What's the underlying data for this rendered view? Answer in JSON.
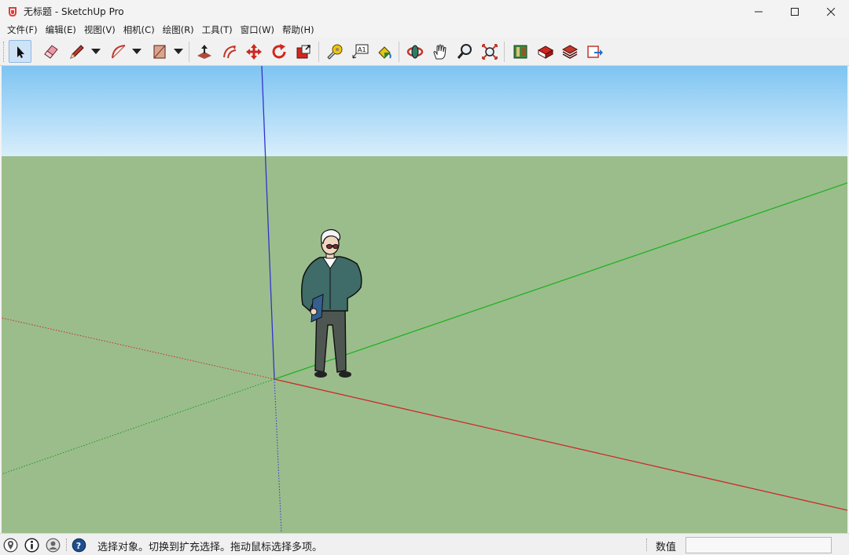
{
  "window": {
    "title": "无标题 - SketchUp Pro",
    "app_icon": "sketchup-logo-icon",
    "controls": [
      "minimize-icon",
      "maximize-icon",
      "close-icon"
    ]
  },
  "menu": {
    "items": [
      "文件(F)",
      "编辑(E)",
      "视图(V)",
      "相机(C)",
      "绘图(R)",
      "工具(T)",
      "窗口(W)",
      "帮助(H)"
    ]
  },
  "toolbar": {
    "tools": [
      {
        "name": "select-tool",
        "icon": "arrow-pointer-icon",
        "active": true
      },
      {
        "name": "eraser-tool",
        "icon": "eraser-icon"
      },
      {
        "name": "line-tool",
        "icon": "pencil-icon",
        "dropdown": true
      },
      {
        "name": "arc-tool",
        "icon": "arc-icon",
        "dropdown": true
      },
      {
        "name": "rectangle-tool",
        "icon": "rectangle-icon",
        "dropdown": true
      },
      {
        "name": "push-pull-tool",
        "icon": "push-pull-icon"
      },
      {
        "name": "offset-tool",
        "icon": "offset-icon"
      },
      {
        "name": "move-tool",
        "icon": "move-icon"
      },
      {
        "name": "rotate-tool",
        "icon": "rotate-icon"
      },
      {
        "name": "scale-tool",
        "icon": "scale-icon"
      },
      {
        "name": "tape-measure-tool",
        "icon": "tape-measure-icon"
      },
      {
        "name": "text-tool",
        "icon": "text-label-icon"
      },
      {
        "name": "paint-bucket-tool",
        "icon": "paint-bucket-icon"
      },
      {
        "name": "orbit-tool",
        "icon": "orbit-icon"
      },
      {
        "name": "pan-tool",
        "icon": "hand-icon"
      },
      {
        "name": "zoom-tool",
        "icon": "magnifier-icon"
      },
      {
        "name": "zoom-extents-tool",
        "icon": "zoom-extents-icon"
      },
      {
        "name": "warehouse-tool",
        "icon": "3d-warehouse-icon"
      },
      {
        "name": "extension-warehouse-tool",
        "icon": "extension-warehouse-icon"
      },
      {
        "name": "layout-tool",
        "icon": "layout-icon"
      },
      {
        "name": "send-to-layout-tool",
        "icon": "send-to-layout-icon"
      }
    ],
    "text_tool_label": "A1"
  },
  "viewport": {
    "sky_color": "#7ec4f2",
    "ground_color": "#9bbd8c",
    "axis_colors": {
      "red": "#cc2a2a",
      "green": "#1fb31f",
      "blue": "#3333cc"
    },
    "model": "scale-figure-person"
  },
  "status": {
    "icons": [
      "geo-location-icon",
      "credits-icon",
      "user-icon",
      "help-icon"
    ],
    "message": "选择对象。切换到扩充选择。拖动鼠标选择多项。",
    "vcb_label": "数值",
    "vcb_value": ""
  }
}
